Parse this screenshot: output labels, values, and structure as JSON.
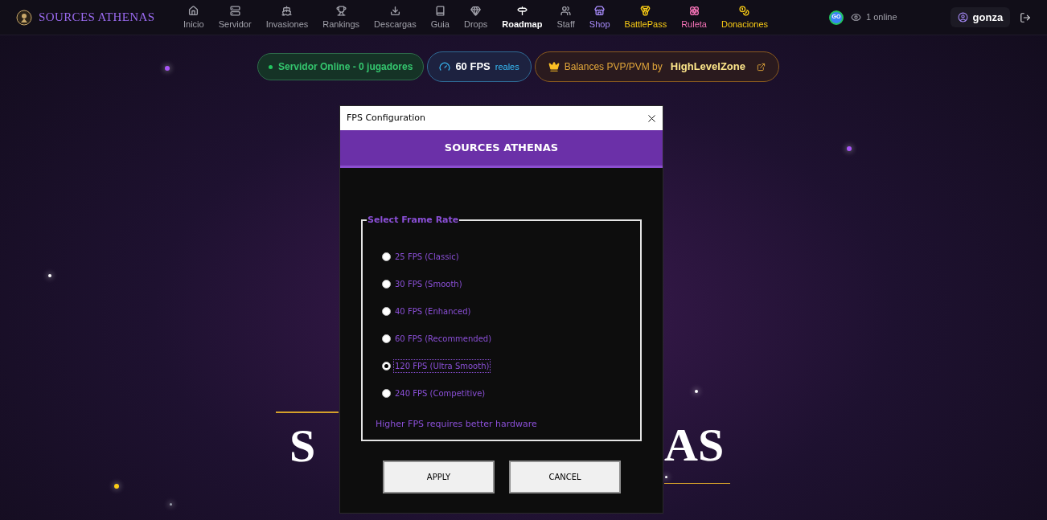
{
  "brand": "SOURCES ATHENAS",
  "nav": [
    {
      "label": "Inicio",
      "color": "#a1a1aa",
      "selected": false
    },
    {
      "label": "Servidor",
      "color": "#a1a1aa",
      "selected": false
    },
    {
      "label": "Invasiones",
      "color": "#a1a1aa",
      "selected": false
    },
    {
      "label": "Rankings",
      "color": "#a1a1aa",
      "selected": false
    },
    {
      "label": "Descargas",
      "color": "#a1a1aa",
      "selected": false
    },
    {
      "label": "Guia",
      "color": "#a1a1aa",
      "selected": false
    },
    {
      "label": "Drops",
      "color": "#a1a1aa",
      "selected": false
    },
    {
      "label": "Roadmap",
      "color": "#ffffff",
      "selected": true
    },
    {
      "label": "Staff",
      "color": "#a1a1aa",
      "selected": false
    },
    {
      "label": "Shop",
      "color": "#a78bfa",
      "selected": false
    },
    {
      "label": "BattlePass",
      "color": "#facc15",
      "selected": false
    },
    {
      "label": "Ruleta",
      "color": "#f472b6",
      "selected": false
    },
    {
      "label": "Donaciones",
      "color": "#facc15",
      "selected": false
    }
  ],
  "avatar": "GO",
  "online": "1 online",
  "user": "gonza",
  "pills": {
    "status": "Servidor Online - 0 jugadores",
    "fps": "60 FPS",
    "fps_note": "reales",
    "balance": "Balances PVP/PVM by",
    "balance_brand": "**High**LevelZone"
  },
  "hero": {
    "left": "S",
    "right": "AS"
  },
  "dialog": {
    "title": "FPS Configuration",
    "header": "SOURCES ATHENAS",
    "group": "Select Frame Rate",
    "options": [
      {
        "label": "25 FPS (Classic)",
        "selected": false
      },
      {
        "label": "30 FPS (Smooth)",
        "selected": false
      },
      {
        "label": "40 FPS (Enhanced)",
        "selected": false
      },
      {
        "label": "60 FPS (Recommended)",
        "selected": false
      },
      {
        "label": "120 FPS (Ultra Smooth)",
        "selected": true
      },
      {
        "label": "240 FPS (Competitive)",
        "selected": false
      }
    ],
    "hint": "Higher FPS requires better hardware",
    "buttons": [
      "APPLY",
      "CANCEL"
    ]
  }
}
